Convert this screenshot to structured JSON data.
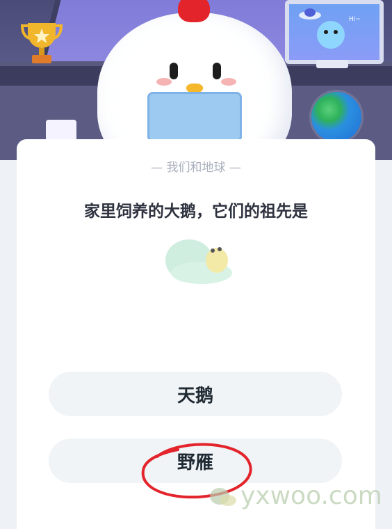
{
  "quiz": {
    "category": "— 我们和地球 —",
    "question": "家里饲养的大鹅，它们的祖先是",
    "options": [
      "天鹅",
      "野雁"
    ]
  },
  "watermark": "yxwoo.com",
  "colors": {
    "accent_red": "#e3242b",
    "card_bg": "#ffffff",
    "option_bg": "#f0f4f7"
  }
}
